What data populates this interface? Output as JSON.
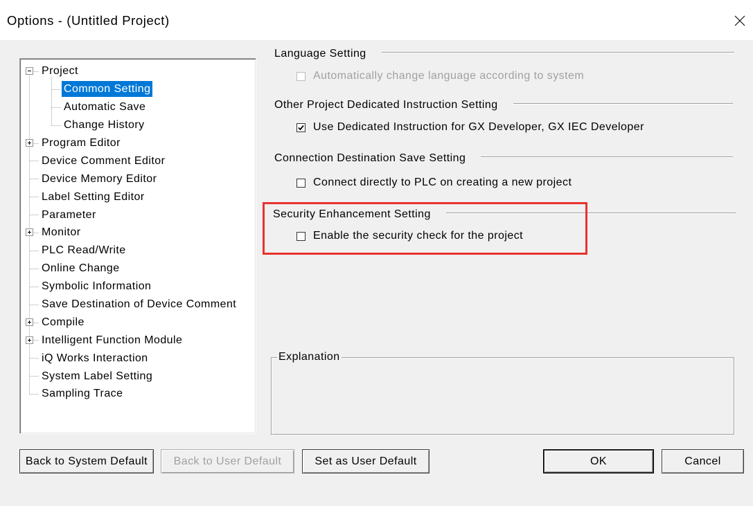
{
  "window": {
    "title": "Options - (Untitled Project)"
  },
  "tree": {
    "items": [
      {
        "label": "Project",
        "level": 0,
        "expander": "expanded"
      },
      {
        "label": "Common Setting",
        "level": 1,
        "selected": true
      },
      {
        "label": "Automatic Save",
        "level": 1
      },
      {
        "label": "Change History",
        "level": 1
      },
      {
        "label": "Program Editor",
        "level": 0,
        "expander": "collapsed"
      },
      {
        "label": "Device Comment Editor",
        "level": 0
      },
      {
        "label": "Device Memory Editor",
        "level": 0
      },
      {
        "label": "Label Setting Editor",
        "level": 0
      },
      {
        "label": "Parameter",
        "level": 0
      },
      {
        "label": "Monitor",
        "level": 0,
        "expander": "collapsed"
      },
      {
        "label": "PLC Read/Write",
        "level": 0
      },
      {
        "label": "Online Change",
        "level": 0
      },
      {
        "label": "Symbolic Information",
        "level": 0
      },
      {
        "label": "Save Destination of Device Comment",
        "level": 0
      },
      {
        "label": "Compile",
        "level": 0,
        "expander": "collapsed"
      },
      {
        "label": "Intelligent Function Module",
        "level": 0,
        "expander": "collapsed"
      },
      {
        "label": "iQ Works Interaction",
        "level": 0
      },
      {
        "label": "System Label Setting",
        "level": 0
      },
      {
        "label": "Sampling Trace",
        "level": 0
      }
    ]
  },
  "settings": {
    "language": {
      "heading": "Language Setting",
      "label": "Automatically change language according to system",
      "checked": false,
      "enabled": false
    },
    "dedicated_instruction": {
      "heading": "Other Project Dedicated Instruction Setting",
      "label": "Use Dedicated Instruction for GX Developer, GX IEC Developer",
      "checked": true,
      "enabled": true
    },
    "connection_destination": {
      "heading": "Connection Destination Save Setting",
      "label": "Connect directly to PLC on creating a new project",
      "checked": false,
      "enabled": true
    },
    "security": {
      "heading": "Security Enhancement Setting",
      "label": "Enable the security check for the project",
      "checked": false,
      "enabled": true,
      "highlighted": true
    }
  },
  "explanation": {
    "title": "Explanation"
  },
  "buttons": {
    "back_to_system_default": {
      "label": "Back to System Default",
      "enabled": true
    },
    "back_to_user_default": {
      "label": "Back to User Default",
      "enabled": false
    },
    "set_as_user_default": {
      "label": "Set as User Default",
      "enabled": true
    },
    "ok": {
      "label": "OK",
      "enabled": true,
      "default": true
    },
    "cancel": {
      "label": "Cancel",
      "enabled": true
    }
  },
  "colors": {
    "selection": "#0078d7",
    "annotation_highlight": "#e8322e",
    "dialog_background": "#f0f0f0"
  },
  "icons": {
    "close": "close-icon",
    "collapse": "collapse-icon",
    "expand": "expand-icon",
    "check": "checkmark-icon"
  }
}
